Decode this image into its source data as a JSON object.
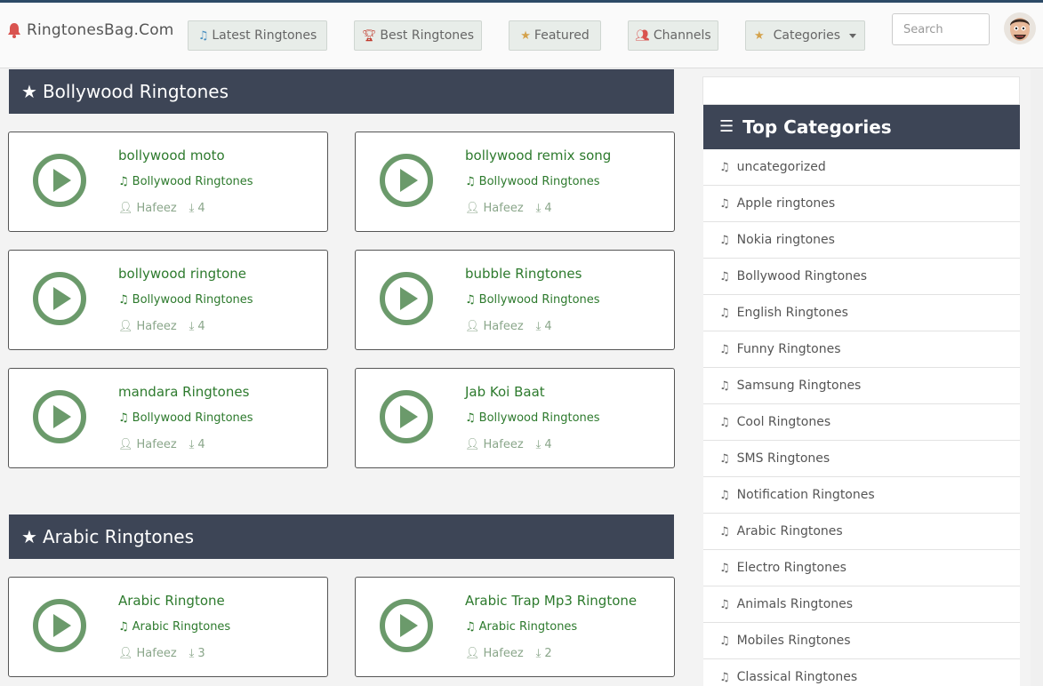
{
  "site": {
    "brand": "RingtonesBag.Com"
  },
  "nav": {
    "latest": "Latest Ringtones",
    "best": "Best Ringtones",
    "featured": "Featured",
    "channels": "Channels",
    "categories": "Categories",
    "search_placeholder": "Search"
  },
  "sections": [
    {
      "title": "Bollywood Ringtones",
      "items": [
        {
          "title": "bollywood moto",
          "category": "Bollywood Ringtones",
          "author": "Hafeez",
          "downloads": "4"
        },
        {
          "title": "bollywood remix song",
          "category": "Bollywood Ringtones",
          "author": "Hafeez",
          "downloads": "4"
        },
        {
          "title": "bollywood ringtone",
          "category": "Bollywood Ringtones",
          "author": "Hafeez",
          "downloads": "4"
        },
        {
          "title": "bubble Ringtones",
          "category": "Bollywood Ringtones",
          "author": "Hafeez",
          "downloads": "4"
        },
        {
          "title": "mandara Ringtones",
          "category": "Bollywood Ringtones",
          "author": "Hafeez",
          "downloads": "4"
        },
        {
          "title": "Jab Koi Baat",
          "category": "Bollywood Ringtones",
          "author": "Hafeez",
          "downloads": "4"
        }
      ]
    },
    {
      "title": "Arabic Ringtones",
      "items": [
        {
          "title": "Arabic Ringtone",
          "category": "Arabic Ringtones",
          "author": "Hafeez",
          "downloads": "3"
        },
        {
          "title": "Arabic Trap Mp3 Ringtone",
          "category": "Arabic Ringtones",
          "author": "Hafeez",
          "downloads": "2"
        }
      ]
    }
  ],
  "sidebar": {
    "title": "Top Categories",
    "categories": [
      "uncategorized",
      "Apple ringtones",
      "Nokia ringtones",
      "Bollywood Ringtones",
      "English Ringtones",
      "Funny Ringtones",
      "Samsung Ringtones",
      "Cool Ringtones",
      "SMS Ringtones",
      "Notification Ringtones",
      "Arabic Ringtones",
      "Electro Ringtones",
      "Animals Ringtones",
      "Mobiles Ringtones",
      "Classical Ringtones"
    ]
  },
  "colors": {
    "header_bar": "#3d4556",
    "title_green": "#2d7a2d",
    "play_green": "#6b9a6b",
    "meta_green": "#8aa68a",
    "nav_button": "#e8ede9"
  },
  "icons": {
    "brand": "bell-icon",
    "latest": "music-note-icon",
    "best": "trophy-icon",
    "featured": "star-icon",
    "channels": "users-icon",
    "categories": "star-icon",
    "section": "star-icon",
    "sidebar": "list-icon",
    "card_play": "play-circle-icon",
    "card_category": "music-note-icon",
    "card_author": "user-icon",
    "card_downloads": "download-icon"
  }
}
